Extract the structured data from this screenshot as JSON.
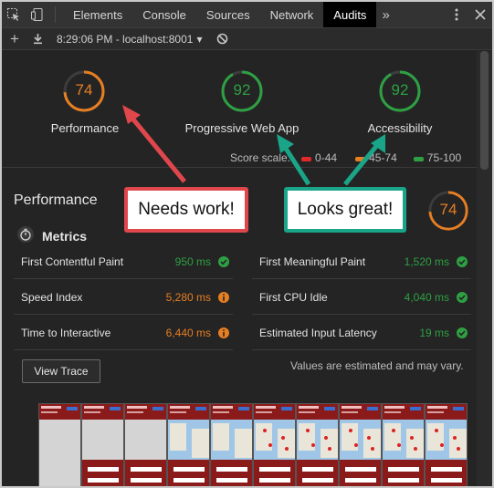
{
  "toolbar": {
    "tabs": [
      "Elements",
      "Console",
      "Sources",
      "Network",
      "Audits"
    ],
    "active_tab": "Audits",
    "more": "»"
  },
  "subbar": {
    "plus": "+",
    "report_select": "8:29:06 PM - localhost:8001",
    "caret": "▾"
  },
  "gauges": [
    {
      "label": "Performance",
      "score": "74",
      "color": "#e67e22",
      "fraction": 0.74
    },
    {
      "label": "Progressive Web App",
      "score": "92",
      "color": "#2ea043",
      "fraction": 0.92
    },
    {
      "label": "Accessibility",
      "score": "92",
      "color": "#2ea043",
      "fraction": 0.92
    }
  ],
  "scale": {
    "label": "Score scale:",
    "ranges": [
      {
        "text": "0-44",
        "color": "#e0292b"
      },
      {
        "text": "45-74",
        "color": "#e67e22"
      },
      {
        "text": "75-100",
        "color": "#2ea043"
      }
    ]
  },
  "performance": {
    "title": "Performance",
    "score": "74",
    "score_fraction": 0.74,
    "metrics_title": "Metrics",
    "metrics": [
      {
        "name": "First Contentful Paint",
        "value": "950 ms",
        "status": "pass"
      },
      {
        "name": "First Meaningful Paint",
        "value": "1,520 ms",
        "status": "pass"
      },
      {
        "name": "Speed Index",
        "value": "5,280 ms",
        "status": "average"
      },
      {
        "name": "First CPU Idle",
        "value": "4,040 ms",
        "status": "pass"
      },
      {
        "name": "Time to Interactive",
        "value": "6,440 ms",
        "status": "average"
      },
      {
        "name": "Estimated Input Latency",
        "value": "19 ms",
        "status": "pass"
      }
    ],
    "view_trace": "View Trace",
    "note": "Values are estimated and may vary."
  },
  "callouts": {
    "left": "Needs work!",
    "right": "Looks great!",
    "left_color": "#e0474c",
    "right_color": "#1aa589"
  },
  "colors": {
    "pass": "#2ea043",
    "average": "#e67e22"
  }
}
